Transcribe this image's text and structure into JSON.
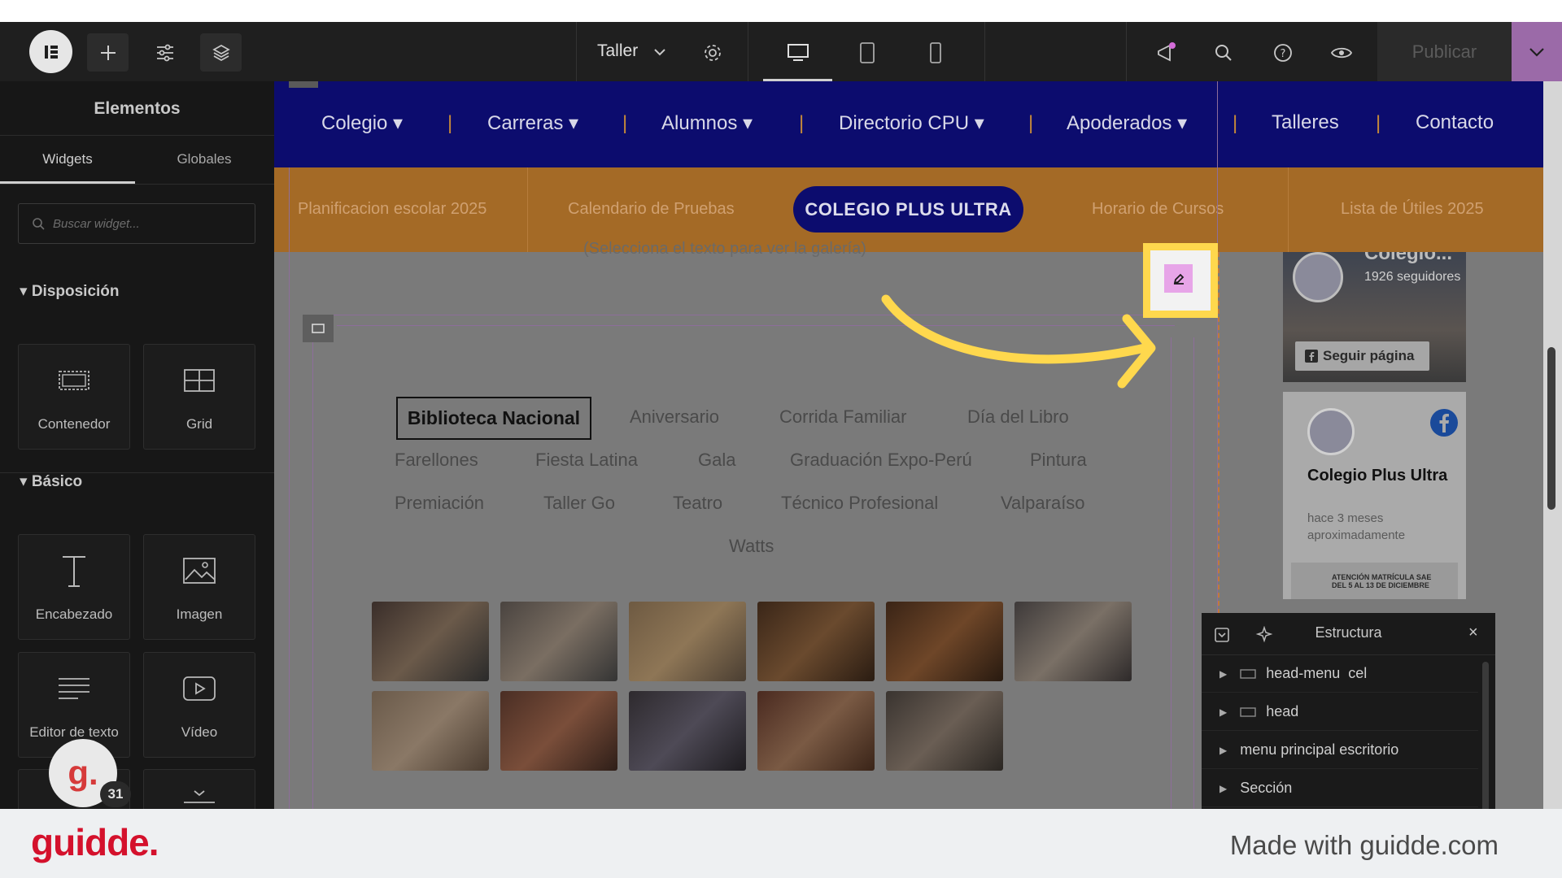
{
  "topbar": {
    "page_name": "Taller",
    "publish_label": "Publicar"
  },
  "panel": {
    "title": "Elementos",
    "tabs": [
      "Widgets",
      "Globales"
    ],
    "search_placeholder": "Buscar widget...",
    "sections": [
      {
        "label": "Disposición",
        "widgets": [
          "Contenedor",
          "Grid"
        ]
      },
      {
        "label": "Básico",
        "widgets": [
          "Encabezado",
          "Imagen",
          "Editor de texto",
          "Vídeo"
        ]
      }
    ],
    "avatar_letter": "g.",
    "avatar_count": "31"
  },
  "site": {
    "nav": [
      "Colegio",
      "Carreras",
      "Alumnos",
      "Directorio CPU",
      "Apoderados",
      "Talleres",
      "Contacto"
    ],
    "subnav": [
      "Planificacion escolar 2025",
      "Calendario de Pruebas",
      "COLEGIO PLUS ULTRA",
      "Horario de Cursos",
      "Lista de Útiles 2025"
    ],
    "hint_text": "(Selecciona el texto para ver la galería)",
    "gallery_tags": {
      "active": "Biblioteca Nacional",
      "row1": [
        "Aniversario",
        "Corrida Familiar",
        "Día del Libro"
      ],
      "row2": [
        "Farellones",
        "Fiesta Latina",
        "Gala",
        "Graduación Expo-Perú",
        "Pintura"
      ],
      "row3": [
        "Premiación",
        "Taller Go",
        "Teatro",
        "Técnico Profesional",
        "Valparaíso"
      ],
      "row4": [
        "Watts"
      ]
    },
    "facebook": {
      "page_name_short": "Colegio...",
      "followers": "1926 seguidores",
      "follow_label": "Seguir página",
      "post_author": "Colegio Plus Ultra",
      "post_time": "hace 3 meses aproximadamente",
      "post_snippet": "ATENCIÓN MATRÍCULA SAE DEL 5 AL 13 DE DICIEMBRE"
    }
  },
  "structure": {
    "title": "Estructura",
    "rows": [
      "head-menu  cel",
      "head",
      "menu principal escritorio",
      "Sección"
    ]
  },
  "footer": {
    "brand": "guidde.",
    "text": "Made with guidde.com"
  },
  "colors": {
    "nav_bg": "#0c0c6e",
    "subnav_bg": "#a46a26",
    "highlight": "#ffd84d",
    "edit_button": "#e7a5e8",
    "brand_red": "#d4112c"
  }
}
